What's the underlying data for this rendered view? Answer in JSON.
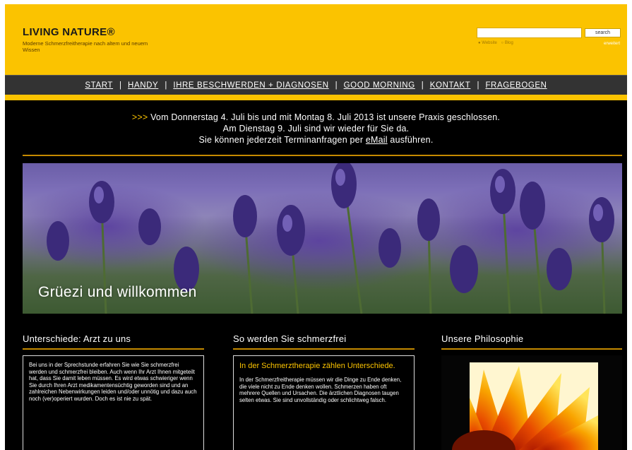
{
  "header": {
    "title": "LIVING NATURE®",
    "tagline": "Moderne Schmerzfreitherapie nach altem und neuem Wissen",
    "search_button": "search",
    "search_options": "[radio] ● Website  ○ Blog",
    "search_advanced": "erweitert"
  },
  "nav": {
    "items": [
      "START",
      "HANDY",
      "IHRE BESCHWERDEN + DIAGNOSEN",
      "GOOD MORNING",
      "KONTAKT",
      "FRAGEBOGEN"
    ],
    "separator": "|"
  },
  "notice": {
    "arrows": ">>>",
    "line1": " Vom Donnerstag 4. Juli bis und mit Montag 8. Juli 2013 ist unsere Praxis geschlossen.",
    "line2": "Am Dienstag 9. Juli sind wir wieder für Sie da.",
    "line3_pre": "Sie können jederzeit Terminanfragen per ",
    "line3_link": "eMail",
    "line3_post": " ausführen."
  },
  "hero": {
    "caption": "Grüezi und willkommen"
  },
  "columns": [
    {
      "title": "Unterschiede: Arzt zu uns",
      "text": "Bei uns in der Sprechstunde erfahren Sie wie Sie schmerzfrei werden und schmerzfrei bleiben. Auch wenn Ihr Arzt Ihnen mitgeteilt hat, dass Sie damit leben müssen. Es wird etwas schwieriger wenn Sie durch Ihren Arzt medikamentensüchtig geworden sind und an zahlreichen Nebenwirkungen leiden und/oder unnötig und dazu auch noch (ver)operiert wurden. Doch es ist nie zu spät."
    },
    {
      "title": "So werden Sie schmerzfrei",
      "highlight": "In der Schmerztherapie zählen Unterschiede.",
      "text": "In der Schmerzfreitherapie müssen wir die Dinge zu Ende denken, die viele nicht zu Ende denken wollen. Schmerzen haben oft mehrere Quellen und Ursachen. Die ärztlichen Diagnosen taugen selten etwas. Sie sind unvollständig oder schlichtweg falsch."
    },
    {
      "title": "Unsere Philosophie"
    }
  ],
  "colors": {
    "brand_yellow": "#fbc300",
    "gold_rule": "#c58a00",
    "nav_gray": "#333333",
    "background": "#000000"
  }
}
